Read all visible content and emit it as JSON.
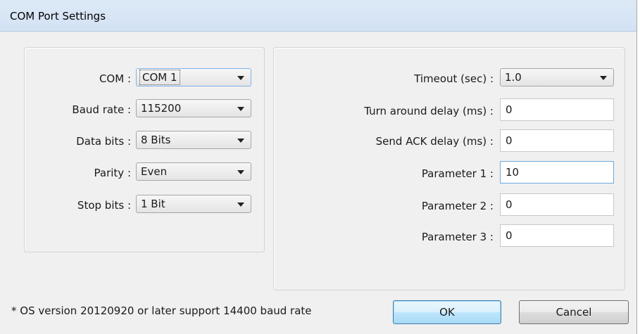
{
  "window": {
    "title": "COM Port Settings"
  },
  "left_panel": {
    "rows": [
      {
        "label": "COM :",
        "value": "COM 1"
      },
      {
        "label": "Baud rate :",
        "value": "115200"
      },
      {
        "label": "Data bits :",
        "value": "8 Bits"
      },
      {
        "label": "Parity :",
        "value": "Even"
      },
      {
        "label": "Stop bits :",
        "value": "1 Bit"
      }
    ]
  },
  "right_panel": {
    "timeout": {
      "label": "Timeout (sec) :",
      "value": "1.0"
    },
    "fields": [
      {
        "label": "Turn around delay (ms) :",
        "value": "0"
      },
      {
        "label": "Send ACK delay (ms) :",
        "value": "0"
      },
      {
        "label": "Parameter 1 :",
        "value": "10"
      },
      {
        "label": "Parameter 2 :",
        "value": "0"
      },
      {
        "label": "Parameter 3 :",
        "value": "0"
      }
    ]
  },
  "footer": {
    "note": "* OS version 20120920 or later support 14400 baud rate",
    "ok_label": "OK",
    "cancel_label": "Cancel"
  }
}
